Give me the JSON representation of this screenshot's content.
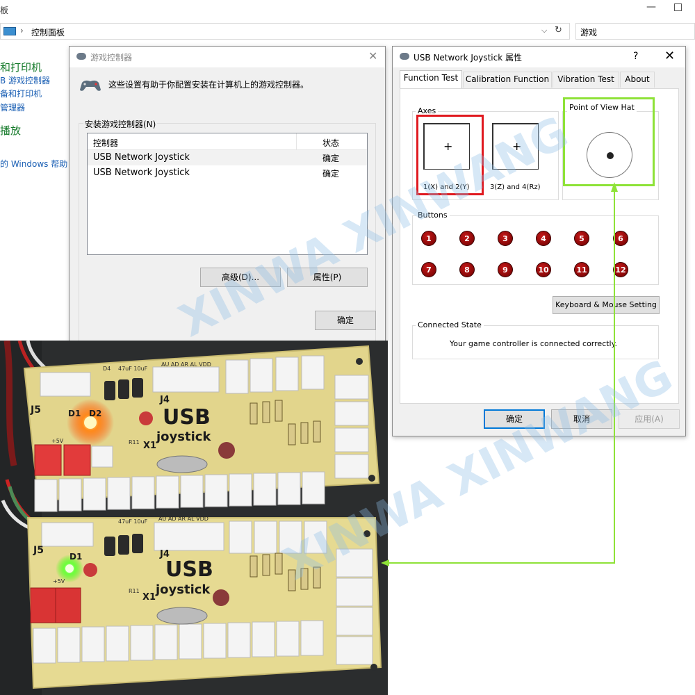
{
  "control_panel": {
    "title_fragment": "板",
    "breadcrumb_sep": "›",
    "path": "控制面板",
    "search_value": "游戏",
    "left_links": [
      {
        "text": "和打印机",
        "big": true
      },
      {
        "text": "B 游戏控制器",
        "big": false
      },
      {
        "text": "备和打印机",
        "big": false
      },
      {
        "text": "管理器",
        "big": false
      },
      {
        "text": "播放",
        "big": true
      },
      {
        "text": "的 Windows 帮助",
        "big": false
      }
    ]
  },
  "game_controllers": {
    "title": "游戏控制器",
    "description": "这些设置有助于你配置安装在计算机上的游戏控制器。",
    "group_label": "安装游戏控制器(N)",
    "columns": {
      "controller": "控制器",
      "status": "状态"
    },
    "rows": [
      {
        "name": "USB Network Joystick",
        "status": "确定"
      },
      {
        "name": "USB Network Joystick",
        "status": "确定"
      }
    ],
    "advanced_button": "高级(D)...",
    "properties_button": "属性(P)",
    "ok_button": "确定"
  },
  "properties": {
    "title": "USB Network Joystick 属性",
    "help": "?",
    "close": "✕",
    "tabs": [
      "Function Test",
      "Calibration Function",
      "Vibration Test",
      "About"
    ],
    "active_tab": "Function Test",
    "axes_label": "Axes",
    "axes": [
      {
        "label": "1(X) and 2(Y)",
        "highlighted": true
      },
      {
        "label": "3(Z) and 4(Rz)",
        "highlighted": false
      }
    ],
    "pov_label": "Point of View Hat",
    "buttons_label": "Buttons",
    "buttons": [
      "1",
      "2",
      "3",
      "4",
      "5",
      "6",
      "7",
      "8",
      "9",
      "10",
      "11",
      "12"
    ],
    "keyboard_button": "Keyboard & Mouse Setting",
    "connected_label": "Connected State",
    "connected_text": "Your game controller is connected correctly.",
    "ok_button": "确定",
    "cancel_button": "取消",
    "apply_button": "应用(A)"
  },
  "board_labels": {
    "usb": "USB",
    "joystick": "joystick",
    "j5": "J5",
    "j4": "J4",
    "d1": "D1",
    "d2": "D2",
    "d4": "D4",
    "x1": "X1",
    "r11": "R11",
    "plus5v": "+5V",
    "header": "AU AD AR AL VDD",
    "cap": "47uF 10uF"
  },
  "watermark": "XINWA XINWANG",
  "colors": {
    "red_highlight": "#e0191f",
    "green_highlight": "#8ee238",
    "button_red": "#a50e0e"
  }
}
